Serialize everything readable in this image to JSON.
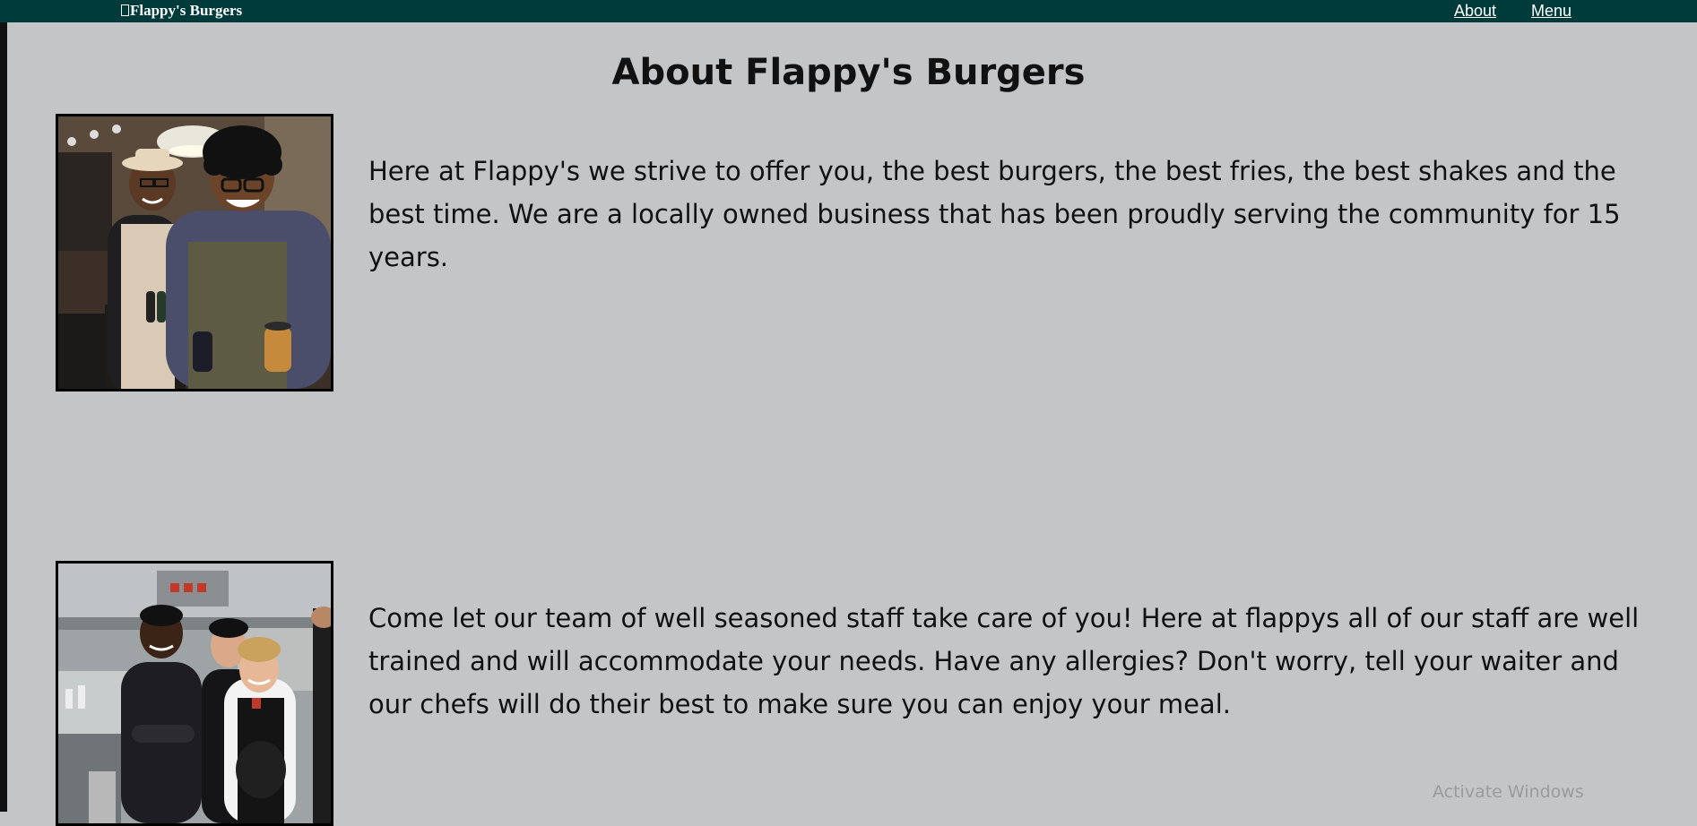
{
  "navbar": {
    "brand": "Flappy's Burgers",
    "links": [
      {
        "label": "About"
      },
      {
        "label": "Menu"
      }
    ]
  },
  "main": {
    "title": "About Flappy's Burgers",
    "sections": [
      {
        "image_subject": "two smiling staff in aprons holding condiment bottles",
        "text": "Here at Flappy's we strive to offer you, the best burgers, the best fries, the best shakes and the best time. We are a locally owned business that has been proudly serving the community for 15 years."
      },
      {
        "image_subject": "kitchen team in chef uniforms",
        "text": "Come let our team of well seasoned staff take care of you! Here at flappys all of our staff are well trained and will accommodate your needs. Have any allergies? Don't worry, tell your waiter and our chefs will do their best to make sure you can enjoy your meal."
      }
    ]
  },
  "os_overlay": {
    "watermark": "Activate Windows"
  },
  "colors": {
    "navbar_bg": "#003b3b",
    "page_bg": "#c4c5c7",
    "text": "#111111"
  }
}
